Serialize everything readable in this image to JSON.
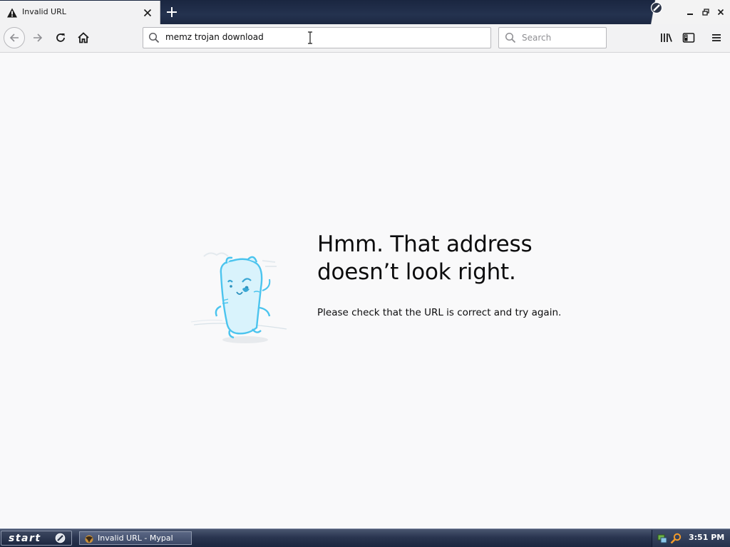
{
  "browser": {
    "tab": {
      "title": "Invalid URL",
      "icon": "warning-icon"
    },
    "new_tab_icon": "plus-icon",
    "nav": {
      "back_icon": "arrow-left-icon",
      "forward_icon": "arrow-right-icon",
      "reload_icon": "reload-icon",
      "home_icon": "home-icon"
    },
    "url_bar": {
      "value": "memz trojan download",
      "icon": "search-icon"
    },
    "search_bar": {
      "placeholder": "Search",
      "icon": "search-icon"
    },
    "toolbar_icons": [
      "library-icon",
      "sidebar-icon",
      "menu-icon"
    ],
    "window_controls": [
      "minimize-icon",
      "restore-icon",
      "close-icon"
    ]
  },
  "error_page": {
    "title": "Hmm. That address doesn’t look right.",
    "description": "Please check that the URL is correct and try again.",
    "illustration": "confused-mascot-illustration"
  },
  "taskbar": {
    "start_label": "start",
    "task_items": [
      {
        "label": "Invalid URL - Mypal",
        "icon": "mypal-app-icon"
      }
    ],
    "tray_icons": [
      "network-icon",
      "search-icon"
    ],
    "clock": "3:51 PM"
  },
  "colors": {
    "chrome_background": "#f2f2f3",
    "tab_strip": "#1f2b45",
    "page_background": "#f9f9fa",
    "text": "#0c0c0d",
    "taskbar": "#2a3550",
    "mascot": "#45c3ee"
  }
}
